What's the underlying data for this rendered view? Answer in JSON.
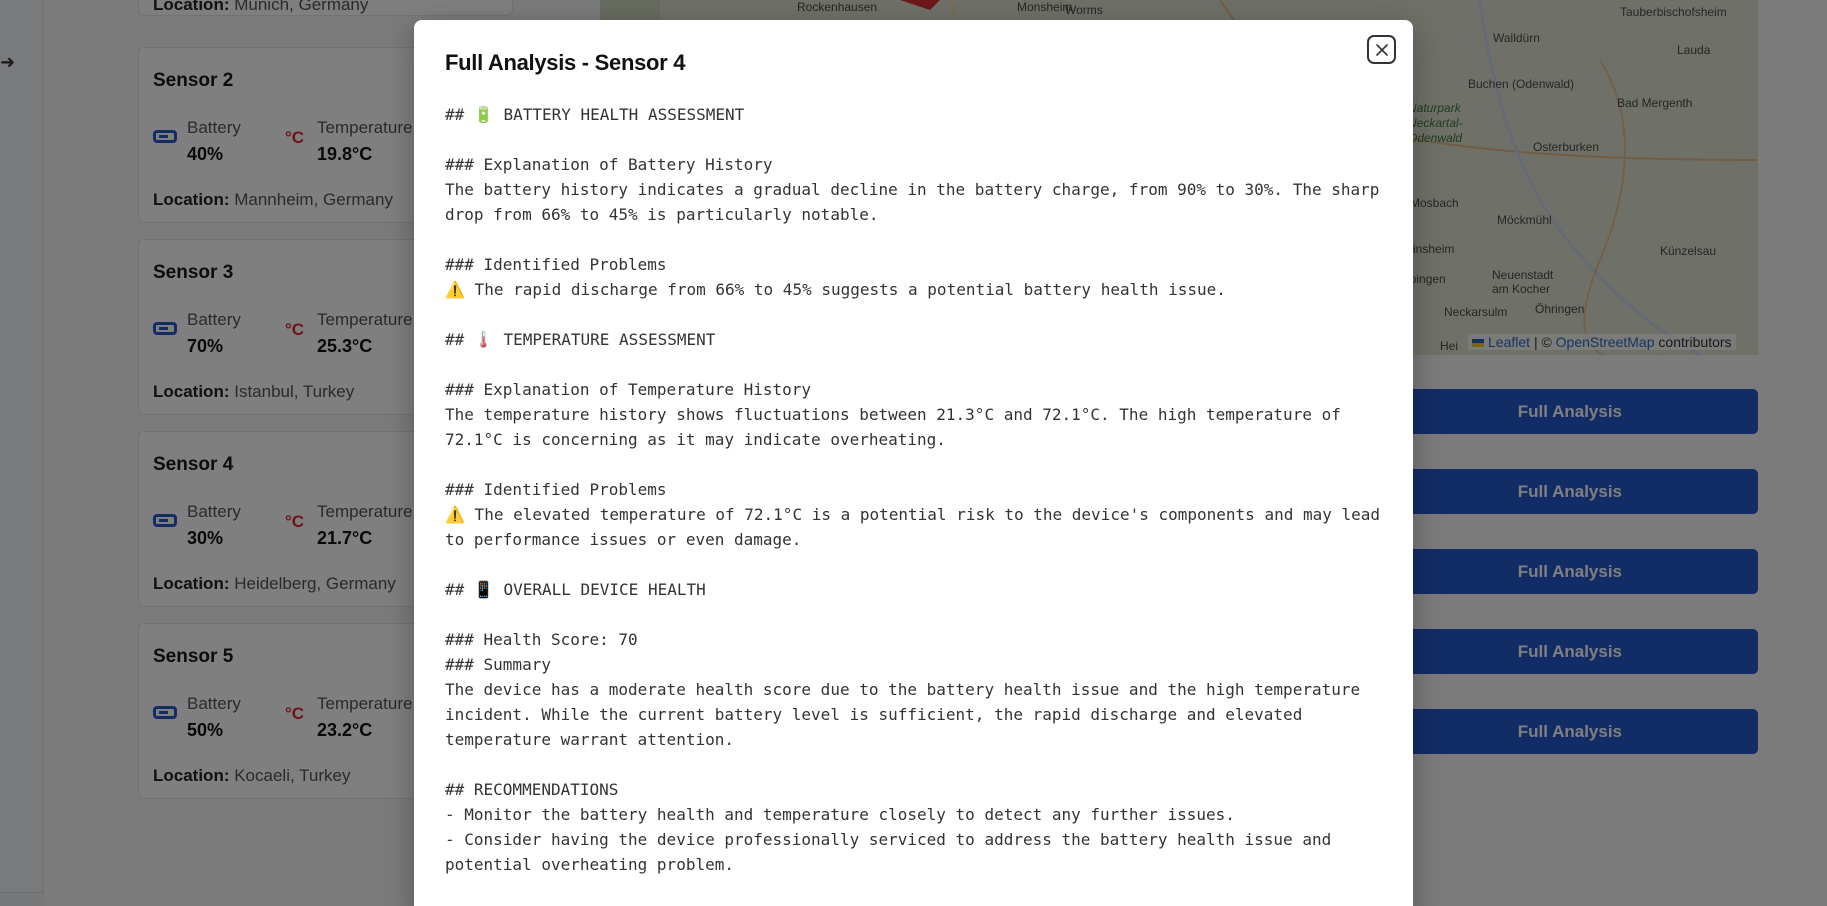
{
  "background": {
    "top_card_location_label": "Location:",
    "top_card_location": "Munich, Germany",
    "sensors": [
      {
        "name": "Sensor 2",
        "battery_label": "Battery",
        "battery": "40%",
        "temp_icon": "°C",
        "temperature_label": "Temperature",
        "temperature": "19.8°C",
        "location_label": "Location:",
        "location": "Mannheim, Germany"
      },
      {
        "name": "Sensor 3",
        "battery_label": "Battery",
        "battery": "70%",
        "temp_icon": "°C",
        "temperature_label": "Temperature",
        "temperature": "25.3°C",
        "location_label": "Location:",
        "location": "Istanbul, Turkey"
      },
      {
        "name": "Sensor 4",
        "battery_label": "Battery",
        "battery": "30%",
        "temp_icon": "°C",
        "temperature_label": "Temperature",
        "temperature": "21.7°C",
        "location_label": "Location:",
        "location": "Heidelberg, Germany"
      },
      {
        "name": "Sensor 5",
        "battery_label": "Battery",
        "battery": "50%",
        "temp_icon": "°C",
        "temperature_label": "Temperature",
        "temperature": "23.2°C",
        "location_label": "Location:",
        "location": "Kocaeli, Turkey"
      }
    ],
    "map": {
      "labels": [
        "Rockenhausen",
        "Monsheim",
        "Worms",
        "Walldürn",
        "Tauberbischofsheim",
        "Lauda",
        "Buchen (Odenwald)",
        "Bad Mergenth",
        "Naturpark",
        "Neckartal-",
        "Odenwald",
        "Osterburken",
        "Mosbach",
        "Möckmühl",
        "Sinsheim",
        "Künzelsau",
        "Neuenstadt",
        "am Kocher",
        "Eppingen",
        "Neckarsulm",
        "Öhringen",
        "Hei"
      ],
      "attribution_leaflet": "Leaflet",
      "attribution_sep": "| ©",
      "attribution_osm": "OpenStreetMap",
      "attribution_suffix": "contributors"
    },
    "full_analysis_label": "Full Analysis",
    "full_analysis_buttons": 5,
    "logout_icon": "logout-icon"
  },
  "modal": {
    "title": "Full Analysis - Sensor 4",
    "close_icon": "close-icon",
    "lines": [
      "## 🔋 BATTERY HEALTH ASSESSMENT",
      "",
      "### Explanation of Battery History",
      "The battery history indicates a gradual decline in the battery charge, from 90% to 30%. The sharp drop from 66% to 45% is particularly notable.",
      "",
      "### Identified Problems",
      "⚠️ The rapid discharge from 66% to 45% suggests a potential battery health issue.",
      "",
      "## 🌡️ TEMPERATURE ASSESSMENT",
      "",
      "### Explanation of Temperature History",
      "The temperature history shows fluctuations between 21.3°C and 72.1°C. The high temperature of 72.1°C is concerning as it may indicate overheating.",
      "",
      "### Identified Problems",
      "⚠️ The elevated temperature of 72.1°C is a potential risk to the device's components and may lead to performance issues or even damage.",
      "",
      "## 📱 OVERALL DEVICE HEALTH",
      "",
      "### Health Score: 70",
      "### Summary",
      "The device has a moderate health score due to the battery health issue and the high temperature incident. While the current battery level is sufficient, the rapid discharge and elevated temperature warrant attention.",
      "",
      "## RECOMMENDATIONS",
      "- Monitor the battery health and temperature closely to detect any further issues.",
      "- Consider having the device professionally serviced to address the battery health issue and potential overheating problem."
    ]
  }
}
